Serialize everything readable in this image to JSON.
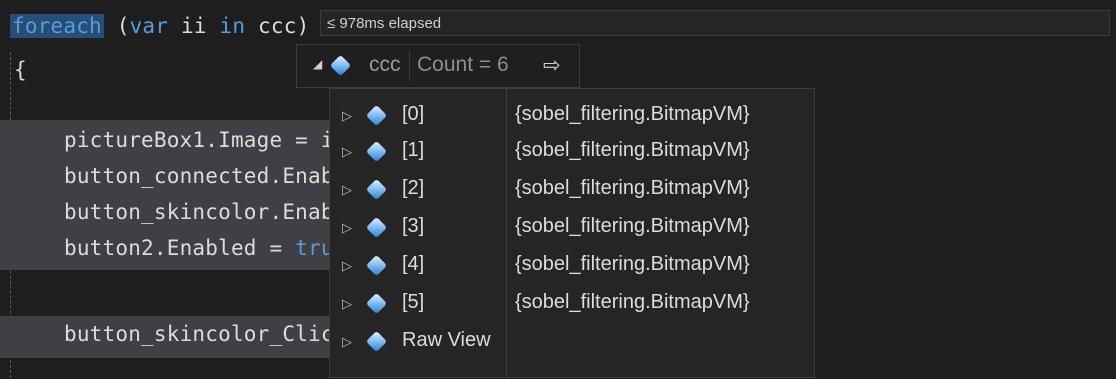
{
  "code": {
    "foreach_line": {
      "kw_foreach": "foreach",
      "paren_open": "(",
      "kw_var": "var",
      "ident": "ii",
      "kw_in": "in",
      "collection": "ccc",
      "paren_close": ")"
    },
    "brace": "{",
    "line_picturebox": {
      "text": "pictureBox1.Image = i"
    },
    "line_connected": {
      "text": "button_connected.Enab"
    },
    "line_skincolor": {
      "text": "button_skincolor.Enab"
    },
    "line_button2": {
      "text": "button2.Enabled = ",
      "kw": "tru"
    },
    "line_click": {
      "text": "button_skincolor_Clic"
    }
  },
  "perf_tip": "≤ 978ms elapsed",
  "datatip": {
    "name": "ccc",
    "count": "Count = 6",
    "pin_icon": "pin-icon",
    "items": [
      {
        "index": "[0]",
        "value": "{sobel_filtering.BitmapVM}"
      },
      {
        "index": "[1]",
        "value": "{sobel_filtering.BitmapVM}"
      },
      {
        "index": "[2]",
        "value": "{sobel_filtering.BitmapVM}"
      },
      {
        "index": "[3]",
        "value": "{sobel_filtering.BitmapVM}"
      },
      {
        "index": "[4]",
        "value": "{sobel_filtering.BitmapVM}"
      },
      {
        "index": "[5]",
        "value": "{sobel_filtering.BitmapVM}"
      }
    ],
    "raw_view": "Raw View"
  },
  "colors": {
    "keyword": "#569cd6",
    "background": "#1e1e1e",
    "selection": "#264f78",
    "highlight": "#3f3f46"
  }
}
